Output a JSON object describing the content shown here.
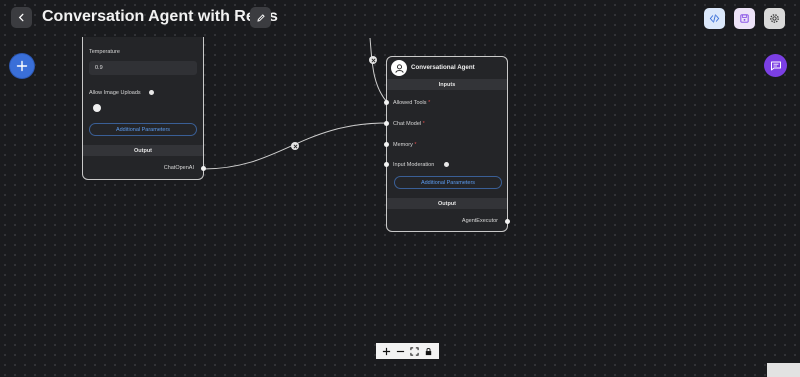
{
  "header": {
    "title": "Conversation Agent with Redis",
    "icons": [
      "chevron-left-icon",
      "pencil-icon",
      "code-icon",
      "save-icon",
      "gear-icon"
    ],
    "colors": {
      "code_btn": "#dbe8fb",
      "save_btn": "#ede3f8",
      "settings_btn": "#d9d9d9"
    }
  },
  "fab": {
    "add_color": "#3a6fd8",
    "chat_color": "#7b3fe4"
  },
  "chat_model_node": {
    "temperature_label": "Temperature",
    "temperature_value": "0.9",
    "image_uploads_label": "Allow Image Uploads",
    "additional_params": "Additional Parameters",
    "output_header": "Output",
    "output_name": "ChatOpenAI"
  },
  "agent_node": {
    "title": "Conversational Agent",
    "inputs_header": "Inputs",
    "inputs": [
      {
        "label": "Allowed Tools",
        "required": "*"
      },
      {
        "label": "Chat Model",
        "required": "*"
      },
      {
        "label": "Memory",
        "required": "*"
      },
      {
        "label": "Input Moderation",
        "required": ""
      }
    ],
    "additional_params": "Additional Parameters",
    "output_header": "Output",
    "output_name": "AgentExecutor"
  },
  "zoom_controls": [
    "plus-icon",
    "minus-icon",
    "fit-view-icon",
    "lock-icon"
  ]
}
